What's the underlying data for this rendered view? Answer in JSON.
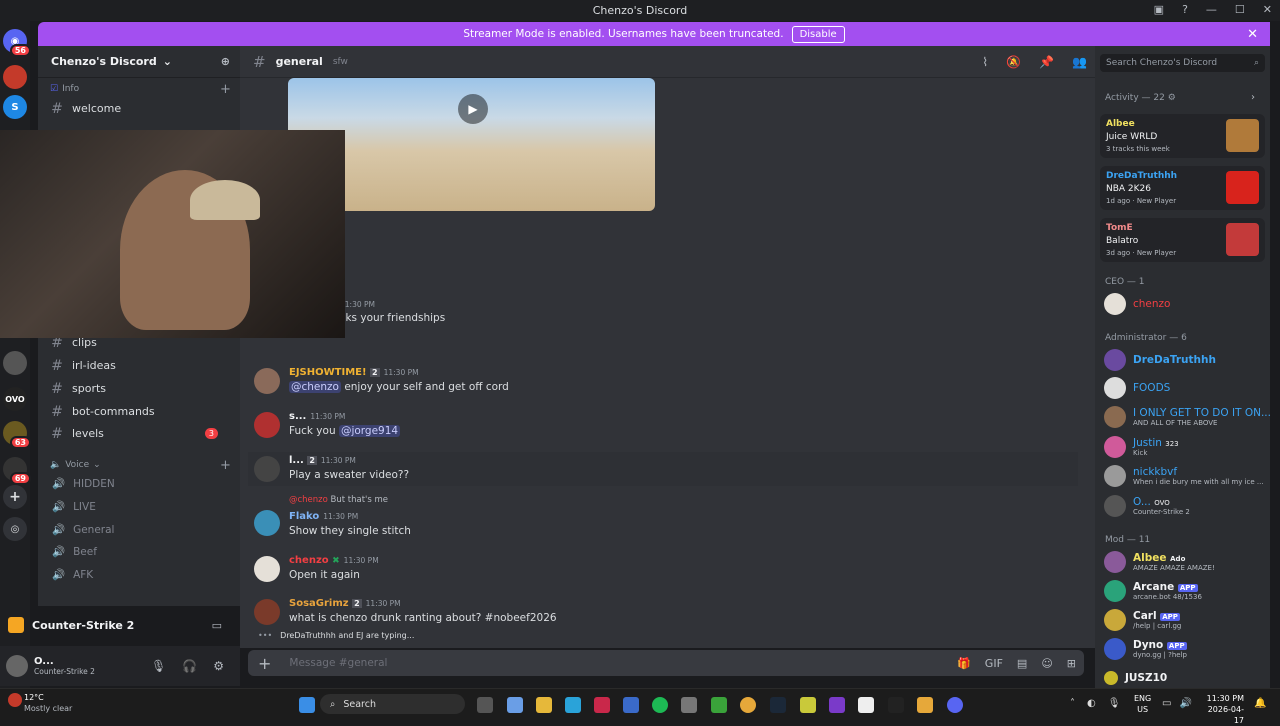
{
  "window": {
    "title": "Chenzo's Discord"
  },
  "banner": {
    "text": "Streamer Mode is enabled. Usernames have been truncated.",
    "disable_label": "Disable"
  },
  "server_rail": {
    "badges": [
      "56",
      "63",
      "69"
    ]
  },
  "sidebar": {
    "server_name": "Chenzo's Discord",
    "category_info": "Info",
    "channels_top": [
      {
        "name": "welcome"
      }
    ],
    "channels": [
      {
        "name": "clips"
      },
      {
        "name": "irl-ideas"
      },
      {
        "name": "sports"
      },
      {
        "name": "bot-commands"
      },
      {
        "name": "levels",
        "badge": "3"
      }
    ],
    "category_voice": "Voice",
    "voice_channels": [
      "HIDDEN",
      "LIVE",
      "General",
      "Beef",
      "AFK"
    ]
  },
  "activity_panel": {
    "game": "Counter-Strike 2"
  },
  "user_panel": {
    "name": "O...",
    "status": "Counter-Strike 2"
  },
  "chat": {
    "channel": "general",
    "topic": "sfw",
    "partial_time": "11:30 PM",
    "partial_text": "sks your friendships",
    "messages": [
      {
        "author": "EJSHOWTIME!",
        "badge": "2",
        "time": "11:30 PM",
        "mention": "@chenzo",
        "text": " enjoy your self and get off cord",
        "color": "#f0b232"
      },
      {
        "author": "s...",
        "time": "11:30 PM",
        "text": "Fuck you ",
        "mention_after": "@jorge914",
        "color": "#f2f3f5"
      },
      {
        "author": "l...",
        "badge": "2",
        "time": "11:30 PM",
        "text": "Play a sweater video??",
        "color": "#f2f3f5"
      },
      {
        "reply_mention": "@chenzo",
        "reply_text": "But that's me",
        "author": "Flako",
        "time": "11:30 PM",
        "text": "Show they single stitch",
        "color": "#7fb3f5"
      },
      {
        "author": "chenzo",
        "time": "11:30 PM",
        "text": "Open it again",
        "color": "#f23f43"
      },
      {
        "author": "SosaGrimz",
        "badge": "2",
        "time": "11:30 PM",
        "text": "what is chenzo drunk ranting about? #nobeef2026",
        "color": "#e8a33d"
      }
    ],
    "typing": "DreDaTruthhh and EJ are typing...",
    "composer_placeholder": "Message #general"
  },
  "right_panel": {
    "search_placeholder": "Search Chenzo's Discord",
    "activity_header": "Activity — 22",
    "activities": [
      {
        "name": "Albee",
        "game": "Juice WRLD",
        "sub": "3 tracks this week",
        "color": "#f0e060"
      },
      {
        "name": "DreDaTruthhh",
        "game": "NBA 2K26",
        "sub": "1d ago · New Player",
        "color": "#3ba3f3"
      },
      {
        "name": "TomE",
        "game": "Balatro",
        "sub": "3d ago · New Player",
        "color": "#f28b8b"
      }
    ],
    "roles": [
      {
        "header": "CEO — 1",
        "members": [
          {
            "name": "chenzo",
            "color": "#f23f43",
            "sub": ""
          }
        ]
      },
      {
        "header": "Administrator — 6",
        "members": [
          {
            "name": "DreDaTruthhh",
            "color": "#3ba3f3",
            "sub": ""
          },
          {
            "name": "FOODS",
            "color": "#3ba3f3",
            "sub": ""
          },
          {
            "name": "I ONLY GET TO DO IT ON...",
            "color": "#3ba3f3",
            "sub": "AND ALL OF THE ABOVE"
          },
          {
            "name": "Justin",
            "color": "#3ba3f3",
            "sub": "Kick",
            "tag": "323"
          },
          {
            "name": "nickkbvf",
            "color": "#3ba3f3",
            "sub": "When i die bury me with all my ice ..."
          },
          {
            "name": "O...",
            "color": "#3ba3f3",
            "sub": "Counter-Strike 2",
            "tag": "OVO"
          }
        ]
      },
      {
        "header": "Mod — 11",
        "members": [
          {
            "name": "Albee",
            "color": "#f0e060",
            "sub": "AMAZE AMAZE AMAZE!",
            "tag": "Ado"
          },
          {
            "name": "Arcane",
            "color": "#f2f3f5",
            "sub": "arcane.bot 48/1536",
            "tag": "APP"
          },
          {
            "name": "Carl",
            "color": "#f2f3f5",
            "sub": "/help | carl.gg",
            "tag": "APP"
          },
          {
            "name": "Dyno",
            "color": "#f2f3f5",
            "sub": "dyno.gg | ?help",
            "tag": "APP"
          },
          {
            "name": "JUSZ10",
            "color": "#f2f3f5",
            "sub": ""
          }
        ]
      }
    ]
  },
  "taskbar": {
    "weather_temp": "12°C",
    "weather_text": "Mostly clear",
    "search_label": "Search",
    "lang": "ENG",
    "region": "US",
    "time": "11:30 PM",
    "date": "2026-04-17"
  }
}
